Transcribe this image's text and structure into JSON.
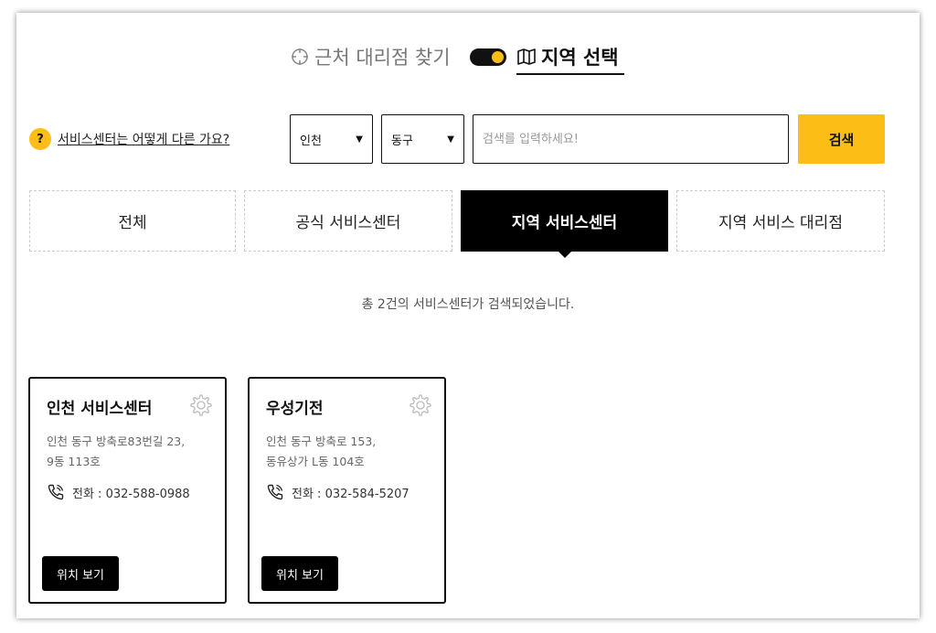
{
  "mode": {
    "nearby_label": "근처 대리점 찾기",
    "region_label": "지역 선택",
    "toggle_on": true,
    "accent_color": "#fbbd16"
  },
  "help": {
    "icon_text": "?",
    "label": "서비스센터는 어떻게 다른 가요?"
  },
  "search": {
    "city_value": "인천",
    "district_value": "동구",
    "placeholder": "검색를 입력하세요!",
    "button_label": "검색"
  },
  "tabs": [
    {
      "label": "전체",
      "active": false
    },
    {
      "label": "공식 서비스센터",
      "active": false
    },
    {
      "label": "지역 서비스센터",
      "active": true
    },
    {
      "label": "지역 서비스 대리점",
      "active": false
    }
  ],
  "result_text": "총 2건의 서비스센터가 검색되었습니다.",
  "cards": [
    {
      "name": "인천 서비스센터",
      "address_line1": "인천 동구 방축로83번길 23,",
      "address_line2": "9동 113호",
      "phone": "전화 : 032-588-0988",
      "button_label": "위치 보기"
    },
    {
      "name": "우성기전",
      "address_line1": "인천 동구 방축로 153,",
      "address_line2": "동유상가 L동 104호",
      "phone": "전화 : 032-584-5207",
      "button_label": "위치 보기"
    }
  ],
  "icons": {
    "nearby": "crosshair-icon",
    "region": "map-icon",
    "card_settings": "gear-icon",
    "phone": "phone-icon"
  }
}
